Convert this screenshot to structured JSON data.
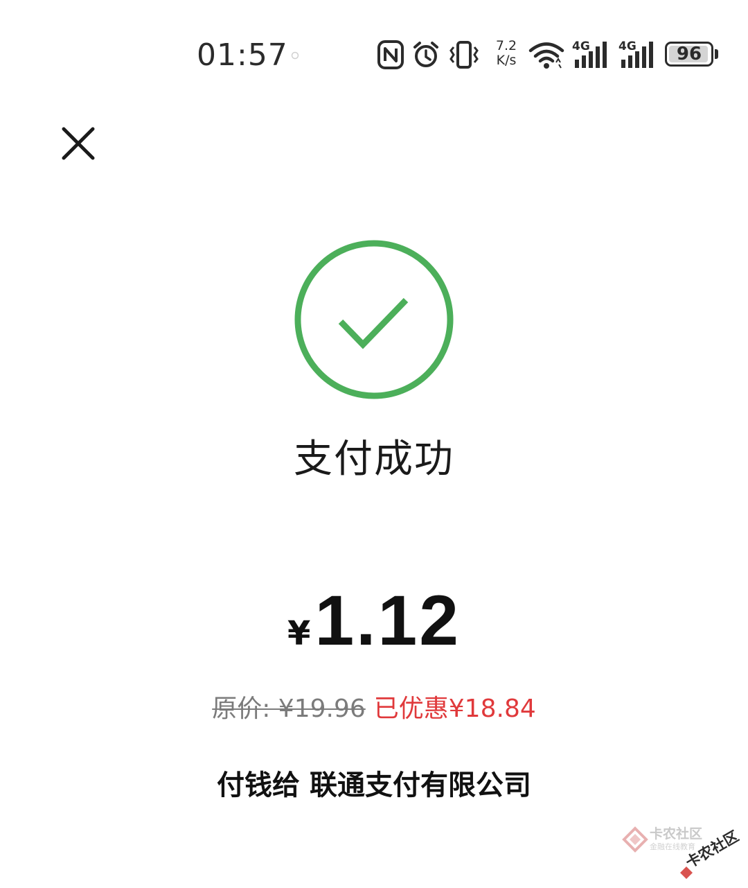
{
  "status_bar": {
    "time": "01:57",
    "net_speed_value": "7.2",
    "net_speed_unit": "K/s",
    "signal_1_type": "4G",
    "signal_2_type": "4G",
    "battery_level": "96",
    "icons": [
      "nfc-icon",
      "alarm-icon",
      "vibrate-icon",
      "wifi-icon",
      "signal-icon",
      "signal-icon",
      "battery-icon"
    ]
  },
  "header": {
    "close_icon": "close-icon"
  },
  "result": {
    "icon": "success-check-icon",
    "accent_color": "#4caf5a",
    "title": "支付成功"
  },
  "payment": {
    "currency_symbol": "¥",
    "amount": "1.12",
    "original_price": "原价: ¥19.96",
    "discount": "已优惠¥18.84",
    "discount_color": "#e0393b",
    "payee_label": "付钱给",
    "payee_name": "联通支付有限公司"
  },
  "watermark": {
    "brand": "卡农社区",
    "tagline": "金融在线教育",
    "stamp": "卡农社区"
  }
}
